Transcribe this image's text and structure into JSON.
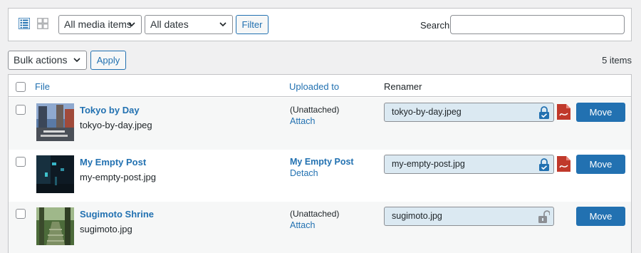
{
  "toolbar": {
    "media_filter": "All media items",
    "date_filter": "All dates",
    "filter_label": "Filter",
    "search_label": "Search",
    "search_value": ""
  },
  "bulk": {
    "bulk_actions": "Bulk actions",
    "apply_label": "Apply",
    "items_count": "5 items"
  },
  "table": {
    "headers": {
      "file": "File",
      "uploaded_to": "Uploaded to",
      "renamer": "Renamer"
    },
    "rows": [
      {
        "title": "Tokyo by Day",
        "filename": "tokyo-by-day.jpeg",
        "uploaded_to": "(Unattached)",
        "uploaded_link": false,
        "action": "Attach",
        "rename_value": "tokyo-by-day.jpeg",
        "locked": true,
        "has_pdf_icon": true,
        "move_label": "Move"
      },
      {
        "title": "My Empty Post",
        "filename": "my-empty-post.jpg",
        "uploaded_to": "My Empty Post",
        "uploaded_link": true,
        "action": "Detach",
        "rename_value": "my-empty-post.jpg",
        "locked": true,
        "has_pdf_icon": true,
        "move_label": "Move"
      },
      {
        "title": "Sugimoto Shrine",
        "filename": "sugimoto.jpg",
        "uploaded_to": "(Unattached)",
        "uploaded_link": false,
        "action": "Attach",
        "rename_value": "sugimoto.jpg",
        "locked": false,
        "has_pdf_icon": false,
        "move_label": "Move"
      }
    ]
  },
  "colors": {
    "accent": "#2271b1",
    "pdf_red": "#c0392b",
    "lock_grey": "#8c8f94",
    "rename_bg": "#dbe9f2"
  }
}
